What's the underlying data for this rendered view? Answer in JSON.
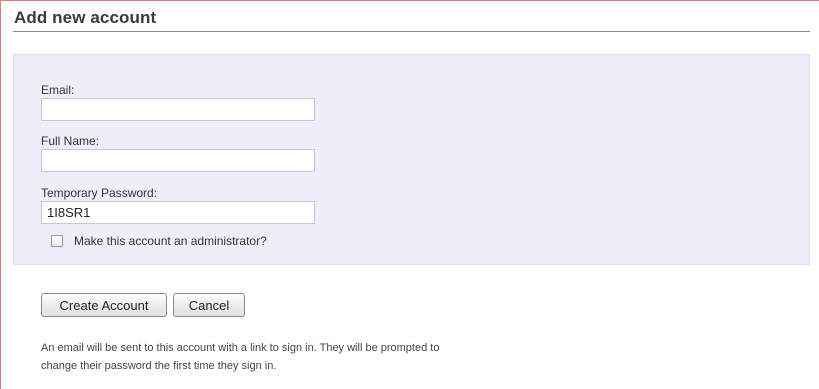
{
  "page": {
    "title": "Add new account"
  },
  "form": {
    "email": {
      "label": "Email:",
      "value": ""
    },
    "full_name": {
      "label": "Full Name:",
      "value": ""
    },
    "temp_password": {
      "label": "Temporary Password:",
      "value": "1I8SR1"
    },
    "admin_checkbox": {
      "label": "Make this account an administrator?",
      "checked": false
    }
  },
  "actions": {
    "create_label": "Create Account",
    "cancel_label": "Cancel"
  },
  "help_text": "An email will be sent to this account with a link to sign in. They will be prompted to change their password the first time they sign in.",
  "colors": {
    "panel_background": "#eeeefb",
    "frame_accent": "#e07a7a"
  }
}
